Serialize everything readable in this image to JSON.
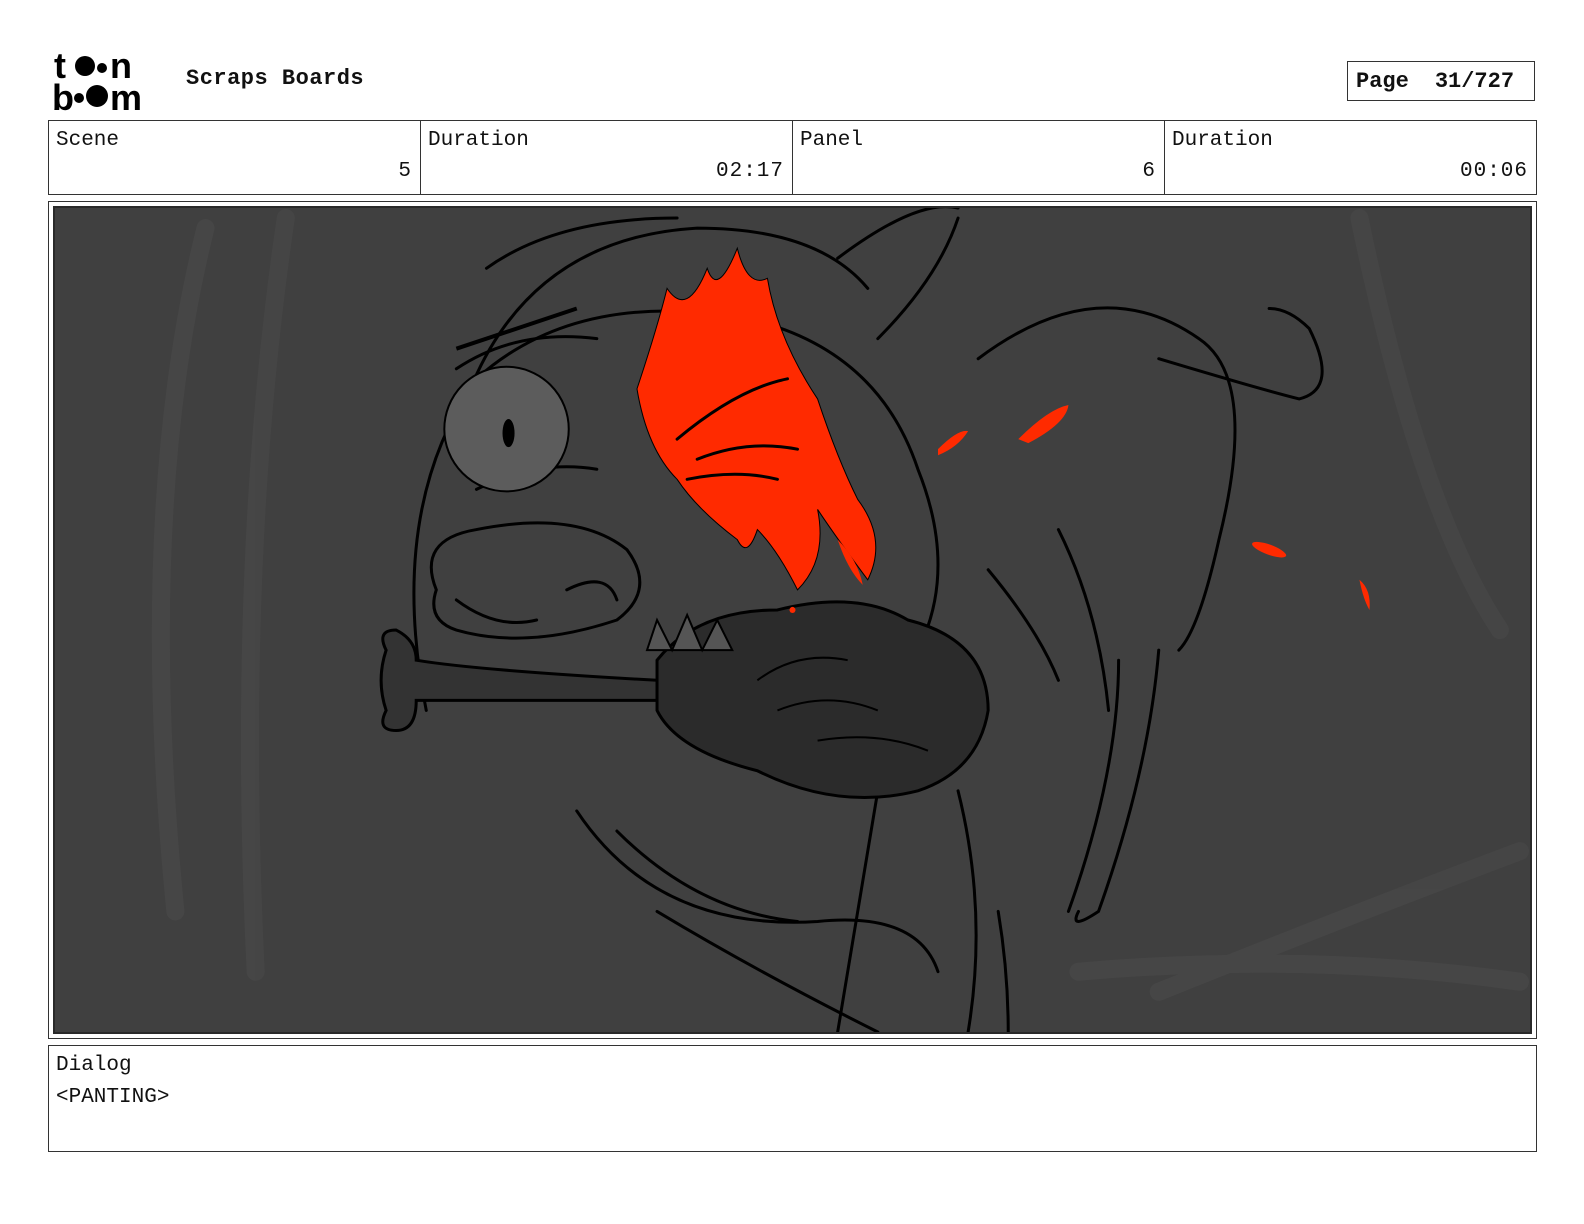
{
  "header": {
    "logo_text": "toonboom",
    "project_title": "Scraps Boards",
    "page_label": "Page",
    "page_value": "31/727"
  },
  "info": {
    "scene_label": "Scene",
    "scene_value": "5",
    "scene_duration_label": "Duration",
    "scene_duration_value": "02:17",
    "panel_label": "Panel",
    "panel_value": "6",
    "panel_duration_label": "Duration",
    "panel_duration_value": "00:06"
  },
  "dialog": {
    "label": "Dialog",
    "text": "<PANTING>"
  },
  "colors": {
    "panel_background": "#404040",
    "accent_red": "#ff2a00",
    "line": "#000000"
  }
}
